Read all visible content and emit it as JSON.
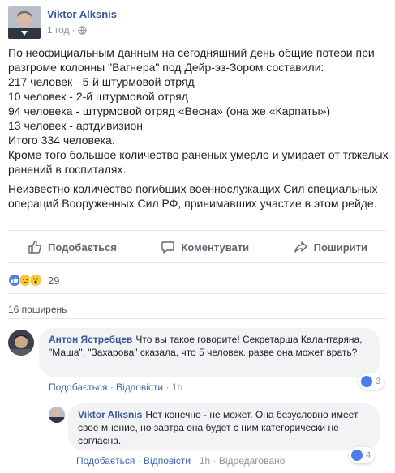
{
  "post": {
    "author": "Viktor Alksnis",
    "time": "1 год",
    "meta_sep": "·",
    "paragraphs": [
      "По неофициальным данным на сегодняшний день общие потери при разгроме колонны \"Вагнера\" под Дейр-эз-Зором составили:\n217 человек - 5-й штурмовой отряд\n10 человек - 2-й штурмовой отряд\n94 человека - штурмовой отряд «Весна» (она же «Карпаты»)\n13 человек - артдивизион\nИтого 334 человека.\nКроме того большое количество раненых умерло и умирает от тяжелых ранений в госпиталях.",
      "Неизвестно количество погибших военнослужащих Сил специальных операций Вооруженных Сил РФ, принимавших участие в этом рейде."
    ]
  },
  "actions": {
    "like": "Подобається",
    "comment": "Коментувати",
    "share": "Поширити"
  },
  "reactions": {
    "count": "29",
    "types": [
      "like",
      "sad",
      "wow"
    ]
  },
  "shares_text": "16 поширень",
  "comments": [
    {
      "author": "Антон Ястребцев",
      "text": "Что вы такое говорите! Секретарша Калантаряна, \"Маша\", \"Захарова\" сказала, что 5 человек. разве она может врать?",
      "like": "Подобається",
      "reply": "Відповісти",
      "time": "1h",
      "sep": "·",
      "reactions_count": "3"
    },
    {
      "author": "Viktor Alksnis",
      "text": "Нет конечно - не может. Она безусловно имеет свое мнение, но завтра она будет с ним категорически не согласна.",
      "like": "Подобається",
      "reply": "Відповісти",
      "time": "1h",
      "edited": "Відредаговано",
      "sep": "·",
      "reactions_count": "4"
    }
  ],
  "colors": {
    "link": "#365899",
    "meta": "#90949c",
    "bubble": "#f2f3f5",
    "like_reaction": "#4b7ded",
    "emoji_reaction": "#f7c93c"
  },
  "icons": [
    "globe-icon",
    "thumbs-up-icon",
    "comment-icon",
    "share-icon",
    "like-reaction-icon",
    "sad-reaction-icon",
    "wow-reaction-icon"
  ]
}
